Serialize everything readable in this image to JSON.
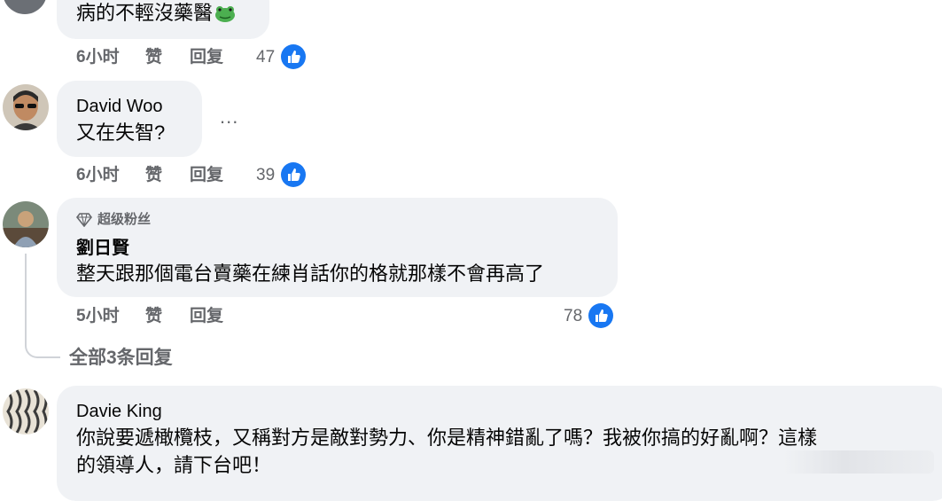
{
  "comments": [
    {
      "author": "",
      "text": "病的不輕沒藥醫",
      "emoji": "frog-face",
      "time": "6小时",
      "like_label": "赞",
      "reply_label": "回复",
      "reactions": "47"
    },
    {
      "author": "David Woo",
      "text": "又在失智?",
      "more": "...",
      "time": "6小时",
      "like_label": "赞",
      "reply_label": "回复",
      "reactions": "39"
    },
    {
      "badge": "超级粉丝",
      "author": "劉日賢",
      "text": "整天跟那個電台賣藥在練肖話你的格就那樣不會再高了",
      "time": "5小时",
      "like_label": "赞",
      "reply_label": "回复",
      "reactions": "78"
    },
    {
      "author": "Davie King",
      "text_line1": "你說要遞橄欖枝，又稱對方是敵對勢力、你是精神錯亂了嗎？我被你搞的好亂啊？這樣",
      "text_line2": "的領導人，請下台吧！"
    }
  ],
  "view_replies": "全部3条回复",
  "colors": {
    "bubble": "#f0f2f5",
    "meta_text": "#65676b",
    "like_blue": "#1877f2",
    "text": "#050505"
  }
}
